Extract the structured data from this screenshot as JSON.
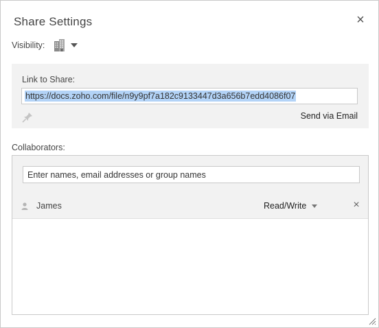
{
  "dialog": {
    "title": "Share Settings",
    "close_icon": "close-icon"
  },
  "visibility": {
    "label": "Visibility:",
    "icon": "building-icon",
    "dropdown_icon": "chevron-down-icon"
  },
  "link": {
    "label": "Link to Share:",
    "url": "https://docs.zoho.com/file/n9y9pf7a182c9133447d3a656b7edd4086f07",
    "selected": true,
    "pin_icon": "pin-icon",
    "send_email_label": "Send via Email"
  },
  "collaborators": {
    "label": "Collaborators:",
    "input_placeholder": "Enter names, email addresses or group names",
    "list": [
      {
        "name": "James",
        "permission": "Read/Write",
        "icon": "user-icon"
      }
    ]
  },
  "colors": {
    "panel_bg": "#f2f2f2",
    "selection": "#b3d3f7",
    "border": "#c9c9c9"
  }
}
